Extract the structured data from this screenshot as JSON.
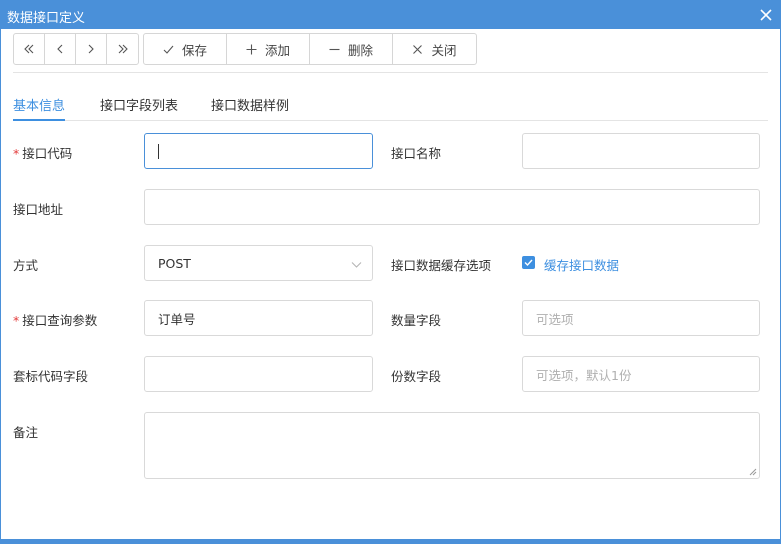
{
  "window": {
    "title": "数据接口定义"
  },
  "toolbar": {
    "nav": [
      {
        "icon": "first-page-icon"
      },
      {
        "icon": "previous-icon"
      },
      {
        "icon": "next-icon"
      },
      {
        "icon": "last-page-icon"
      }
    ],
    "save_label": "保存",
    "add_label": "添加",
    "delete_label": "删除",
    "close_label": "关闭"
  },
  "tabs": [
    {
      "label": "基本信息",
      "active": true
    },
    {
      "label": "接口字段列表",
      "active": false
    },
    {
      "label": "接口数据样例",
      "active": false
    }
  ],
  "form": {
    "required_mark": "*",
    "code": {
      "label": "接口代码",
      "value": ""
    },
    "name": {
      "label": "接口名称",
      "value": ""
    },
    "address": {
      "label": "接口地址",
      "value": ""
    },
    "method": {
      "label": "方式",
      "value": "POST"
    },
    "cache": {
      "label": "接口数据缓存选项",
      "checkbox_label": "缓存接口数据",
      "checked": true
    },
    "query_param": {
      "label": "接口查询参数",
      "value": "订单号"
    },
    "quantity_field": {
      "label": "数量字段",
      "placeholder": "可选项"
    },
    "set_code_field": {
      "label": "套标代码字段",
      "value": ""
    },
    "copies_field": {
      "label": "份数字段",
      "placeholder": "可选项，默认1份"
    },
    "remark": {
      "label": "备注",
      "value": ""
    }
  },
  "colors": {
    "accent": "#4a90d9",
    "active_tab": "#3d8fe0",
    "required": "#e33b3b"
  }
}
